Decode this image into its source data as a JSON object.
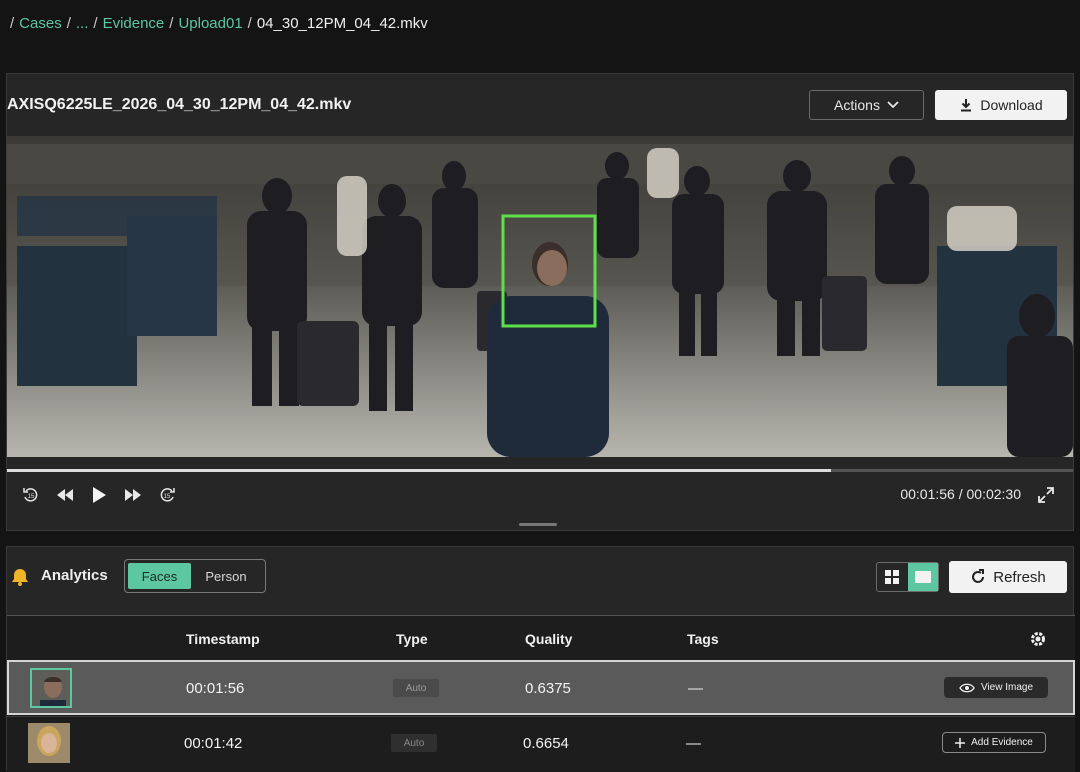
{
  "breadcrumb": {
    "items": [
      {
        "label": "Cases",
        "link": true
      },
      {
        "label": "...",
        "link": true
      },
      {
        "label": "Evidence",
        "link": true
      },
      {
        "label": "Upload01",
        "link": true
      },
      {
        "label": "04_30_12PM_04_42.mkv",
        "link": false
      }
    ],
    "separator": "/"
  },
  "player": {
    "title": "AXISQ6225LE_2026_04_30_12PM_04_42.mkv",
    "actions_label": "Actions",
    "download_label": "Download",
    "progress_fraction": 0.773,
    "time_display": "00:01:56 / 00:02:30",
    "controls": [
      "rewind-15-icon",
      "skip-back-icon",
      "play-icon",
      "skip-forward-icon",
      "forward-15-icon"
    ]
  },
  "analytics": {
    "title": "Analytics",
    "tabs": [
      {
        "label": "Faces",
        "active": true
      },
      {
        "label": "Person",
        "active": false
      }
    ],
    "refresh_label": "Refresh",
    "columns": [
      "Timestamp",
      "Type",
      "Quality",
      "Tags"
    ],
    "rows": [
      {
        "timestamp": "00:01:56",
        "type": "Auto",
        "quality": "0.6375",
        "tags": "—",
        "action": "View Image",
        "selected": true
      },
      {
        "timestamp": "00:01:42",
        "type": "Auto",
        "quality": "0.6654",
        "tags": "—",
        "action": "Add Evidence",
        "selected": false
      }
    ]
  },
  "colors": {
    "accent": "#5cc7a1",
    "background": "#141414",
    "panel": "#262626",
    "detection_box": "#5ee04a"
  }
}
